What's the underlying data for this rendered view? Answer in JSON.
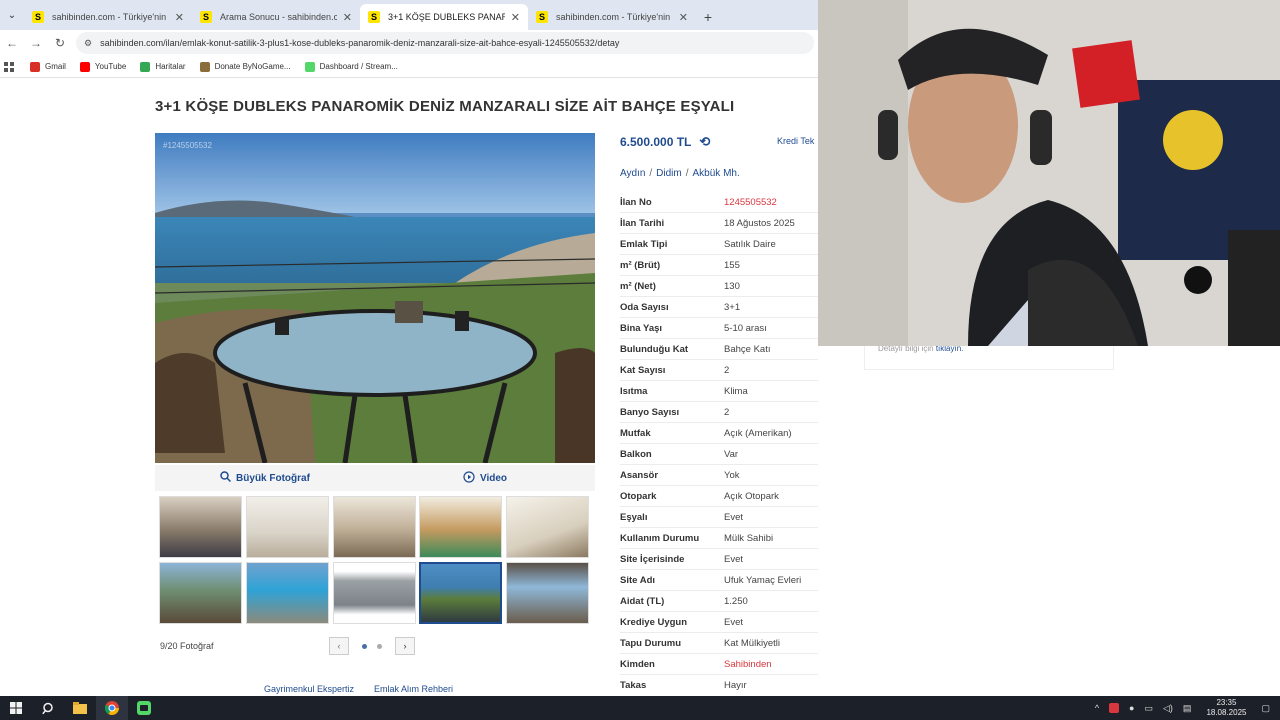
{
  "browser": {
    "tabs": [
      {
        "title": "sahibinden.com - Türkiye'nin O",
        "icon": "S",
        "active": false
      },
      {
        "title": "Arama Sonucu - sahibinden.com",
        "icon": "S",
        "active": false
      },
      {
        "title": "3+1 KÖŞE DUBLEKS PANAROM",
        "icon": "S",
        "active": true
      },
      {
        "title": "sahibinden.com - Türkiye'nin O",
        "icon": "S",
        "active": false
      }
    ],
    "url": "sahibinden.com/ilan/emlak-konut-satilik-3-plus1-kose-dubleks-panaromik-deniz-manzarali-size-ait-bahce-esyali-1245505532/detay",
    "bookmarks": [
      {
        "label": "Gmail",
        "color": "#d93025"
      },
      {
        "label": "YouTube",
        "color": "#ff0000"
      },
      {
        "label": "Haritalar",
        "color": "#34a853"
      },
      {
        "label": "Donate ByNoGame...",
        "color": "#8a6d3b"
      },
      {
        "label": "Dashboard / Stream...",
        "color": "#53d769"
      }
    ]
  },
  "listing": {
    "title": "3+1 KÖŞE DUBLEKS PANAROMİK DENİZ MANZARALI SİZE AİT BAHÇE EŞYALI",
    "photo_id": "#1245505532",
    "big_photo_label": "Büyük Fotoğraf",
    "video_label": "Video",
    "photo_count": "9/20 Fotoğraf",
    "price": "6.500.000 TL",
    "kredi": "Kredi Tek",
    "location": {
      "city": "Aydın",
      "district": "Didim",
      "neighborhood": "Akbük Mh."
    },
    "details": [
      {
        "key": "İlan No",
        "value": "1245505532",
        "accent": true
      },
      {
        "key": "İlan Tarihi",
        "value": "18 Ağustos 2025",
        "accent": false
      },
      {
        "key": "Emlak Tipi",
        "value": "Satılık Daire",
        "accent": false
      },
      {
        "key": "m² (Brüt)",
        "value": "155",
        "accent": false
      },
      {
        "key": "m² (Net)",
        "value": "130",
        "accent": false
      },
      {
        "key": "Oda Sayısı",
        "value": "3+1",
        "accent": false
      },
      {
        "key": "Bina Yaşı",
        "value": "5-10 arası",
        "accent": false
      },
      {
        "key": "Bulunduğu Kat",
        "value": "Bahçe Katı",
        "accent": false
      },
      {
        "key": "Kat Sayısı",
        "value": "2",
        "accent": false
      },
      {
        "key": "Isıtma",
        "value": "Klima",
        "accent": false
      },
      {
        "key": "Banyo Sayısı",
        "value": "2",
        "accent": false
      },
      {
        "key": "Mutfak",
        "value": "Açık (Amerikan)",
        "accent": false
      },
      {
        "key": "Balkon",
        "value": "Var",
        "accent": false
      },
      {
        "key": "Asansör",
        "value": "Yok",
        "accent": false
      },
      {
        "key": "Otopark",
        "value": "Açık Otopark",
        "accent": false
      },
      {
        "key": "Eşyalı",
        "value": "Evet",
        "accent": false
      },
      {
        "key": "Kullanım Durumu",
        "value": "Mülk Sahibi",
        "accent": false
      },
      {
        "key": "Site İçerisinde",
        "value": "Evet",
        "accent": false
      },
      {
        "key": "Site Adı",
        "value": "Ufuk Yamaç Evleri",
        "accent": false
      },
      {
        "key": "Aidat (TL)",
        "value": "1.250",
        "accent": false
      },
      {
        "key": "Krediye Uygun",
        "value": "Evet",
        "accent": false
      },
      {
        "key": "Tapu Durumu",
        "value": "Kat Mülkiyetli",
        "accent": false
      },
      {
        "key": "Kimden",
        "value": "Sahibinden",
        "accent": true
      },
      {
        "key": "Takas",
        "value": "Hayır",
        "accent": false
      }
    ],
    "footer_links": [
      "Gayrimenkul Ekspertiz",
      "Emlak Alım Rehberi"
    ],
    "side_note": {
      "text": "Detaylı bilgi için",
      "link": "tıklayın."
    }
  },
  "taskbar": {
    "time": "23:35",
    "date": "18.08.2025"
  },
  "colors": {
    "accent_blue": "#1f4b8f",
    "accent_red": "#d9363e",
    "brand_yellow": "#ffe600"
  }
}
